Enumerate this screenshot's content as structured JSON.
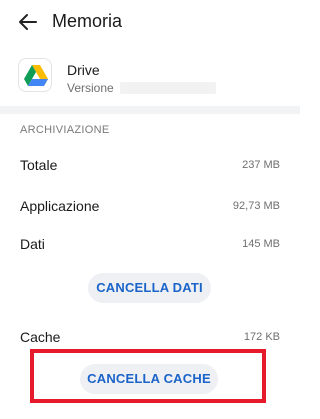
{
  "header": {
    "title": "Memoria",
    "back_icon": "back-arrow-icon"
  },
  "app": {
    "name": "Drive",
    "version_label": "Versione",
    "icon": "google-drive-icon"
  },
  "storage": {
    "section_label": "ARCHIVIAZIONE",
    "rows": [
      {
        "label": "Totale",
        "value": "237 MB"
      },
      {
        "label": "Applicazione",
        "value": "92,73 MB"
      },
      {
        "label": "Dati",
        "value": "145 MB"
      }
    ],
    "clear_data_label": "CANCELLA DATI",
    "cache_label": "Cache",
    "cache_value": "172 KB",
    "clear_cache_label": "CANCELLA CACHE"
  },
  "colors": {
    "accent": "#1b64c9",
    "button_bg": "#eef0f3",
    "highlight": "#e51b2b"
  }
}
